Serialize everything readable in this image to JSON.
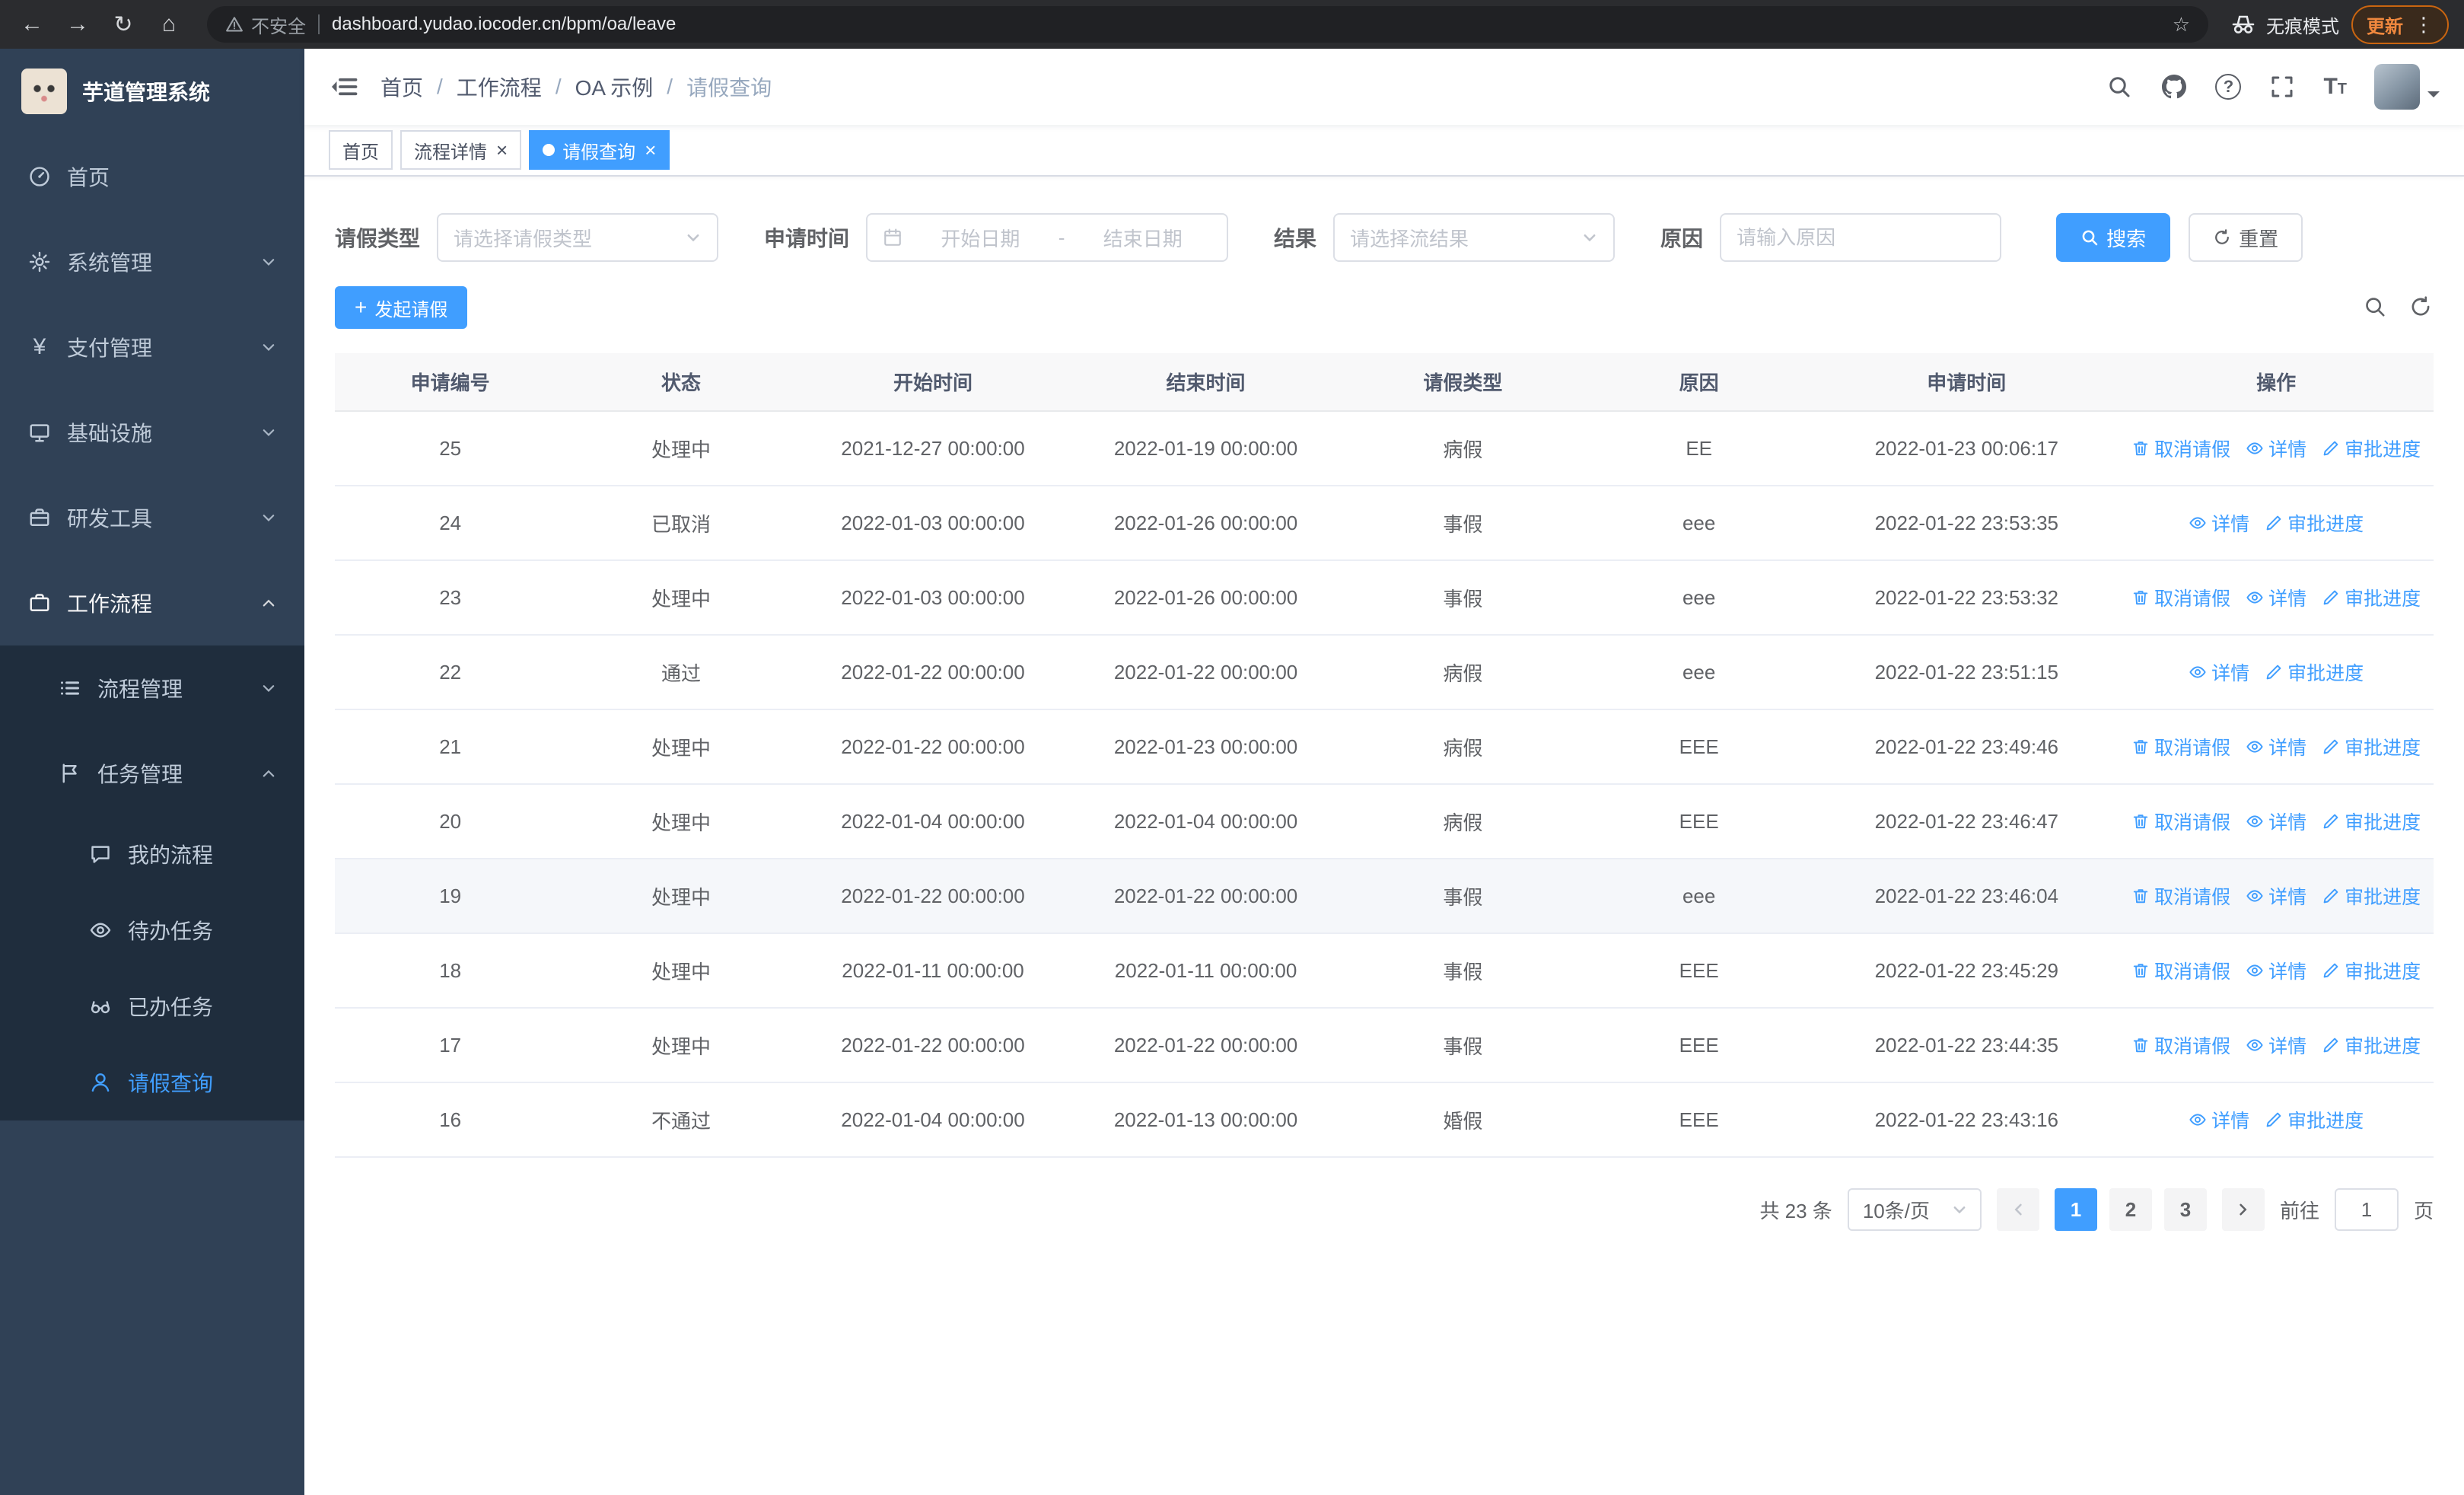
{
  "colors": {
    "accent": "#409eff",
    "sidebar_bg": "#304156",
    "sidebar_submenu_bg": "#1f2d3d",
    "link": "#409eff",
    "update_chip": "#f0883e"
  },
  "browser": {
    "security_label": "不安全",
    "url": "dashboard.yudao.iocoder.cn/bpm/oa/leave",
    "incognito_label": "无痕模式",
    "update_label": "更新"
  },
  "sidebar": {
    "logo_title": "芋道管理系统",
    "items": [
      {
        "label": "首页",
        "icon": "dashboard-icon",
        "level": 1,
        "active": false
      },
      {
        "label": "系统管理",
        "icon": "gear-icon",
        "level": 1,
        "expanded": false
      },
      {
        "label": "支付管理",
        "icon": "yen-icon",
        "level": 1,
        "expanded": false
      },
      {
        "label": "基础设施",
        "icon": "monitor-icon",
        "level": 1,
        "expanded": false
      },
      {
        "label": "研发工具",
        "icon": "briefcase-icon",
        "level": 1,
        "expanded": false
      },
      {
        "label": "工作流程",
        "icon": "briefcase-icon",
        "level": 1,
        "expanded": true
      },
      {
        "label": "流程管理",
        "icon": "list-icon",
        "level": 2,
        "expanded": false
      },
      {
        "label": "任务管理",
        "icon": "flag-icon",
        "level": 2,
        "expanded": true
      },
      {
        "label": "我的流程",
        "icon": "chat-icon",
        "level": 3,
        "active": false
      },
      {
        "label": "待办任务",
        "icon": "eye-icon",
        "level": 3,
        "active": false
      },
      {
        "label": "已办任务",
        "icon": "glasses-icon",
        "level": 3,
        "active": false
      },
      {
        "label": "请假查询",
        "icon": "user-icon",
        "level": 3,
        "active": true
      }
    ]
  },
  "breadcrumb": {
    "items": [
      "首页",
      "工作流程",
      "OA 示例",
      "请假查询"
    ]
  },
  "tabs": [
    {
      "label": "首页",
      "active": false,
      "closable": false
    },
    {
      "label": "流程详情",
      "active": false,
      "closable": true
    },
    {
      "label": "请假查询",
      "active": true,
      "closable": true
    }
  ],
  "filters": {
    "leave_type_label": "请假类型",
    "leave_type_placeholder": "请选择请假类型",
    "apply_time_label": "申请时间",
    "start_date_placeholder": "开始日期",
    "range_separator": "-",
    "end_date_placeholder": "结束日期",
    "result_label": "结果",
    "result_placeholder": "请选择流结果",
    "reason_label": "原因",
    "reason_placeholder": "请输入原因",
    "search_label": "搜索",
    "reset_label": "重置"
  },
  "toolbar": {
    "create_label": "发起请假"
  },
  "table": {
    "columns": [
      "申请编号",
      "状态",
      "开始时间",
      "结束时间",
      "请假类型",
      "原因",
      "申请时间",
      "操作"
    ],
    "action_labels": {
      "cancel": "取消请假",
      "detail": "详情",
      "progress": "审批进度"
    },
    "action_icons": {
      "cancel": "trash-icon",
      "detail": "eye-icon",
      "progress": "edit-icon"
    },
    "rows": [
      {
        "id": "25",
        "status": "处理中",
        "start": "2021-12-27 00:00:00",
        "end": "2022-01-19 00:00:00",
        "type": "病假",
        "reason": "EE",
        "apply_time": "2022-01-23 00:06:17",
        "actions": [
          "cancel",
          "detail",
          "progress"
        ],
        "highlight": false
      },
      {
        "id": "24",
        "status": "已取消",
        "start": "2022-01-03 00:00:00",
        "end": "2022-01-26 00:00:00",
        "type": "事假",
        "reason": "eee",
        "apply_time": "2022-01-22 23:53:35",
        "actions": [
          "detail",
          "progress"
        ],
        "highlight": false
      },
      {
        "id": "23",
        "status": "处理中",
        "start": "2022-01-03 00:00:00",
        "end": "2022-01-26 00:00:00",
        "type": "事假",
        "reason": "eee",
        "apply_time": "2022-01-22 23:53:32",
        "actions": [
          "cancel",
          "detail",
          "progress"
        ],
        "highlight": false
      },
      {
        "id": "22",
        "status": "通过",
        "start": "2022-01-22 00:00:00",
        "end": "2022-01-22 00:00:00",
        "type": "病假",
        "reason": "eee",
        "apply_time": "2022-01-22 23:51:15",
        "actions": [
          "detail",
          "progress"
        ],
        "highlight": false
      },
      {
        "id": "21",
        "status": "处理中",
        "start": "2022-01-22 00:00:00",
        "end": "2022-01-23 00:00:00",
        "type": "病假",
        "reason": "EEE",
        "apply_time": "2022-01-22 23:49:46",
        "actions": [
          "cancel",
          "detail",
          "progress"
        ],
        "highlight": false
      },
      {
        "id": "20",
        "status": "处理中",
        "start": "2022-01-04 00:00:00",
        "end": "2022-01-04 00:00:00",
        "type": "病假",
        "reason": "EEE",
        "apply_time": "2022-01-22 23:46:47",
        "actions": [
          "cancel",
          "detail",
          "progress"
        ],
        "highlight": false
      },
      {
        "id": "19",
        "status": "处理中",
        "start": "2022-01-22 00:00:00",
        "end": "2022-01-22 00:00:00",
        "type": "事假",
        "reason": "eee",
        "apply_time": "2022-01-22 23:46:04",
        "actions": [
          "cancel",
          "detail",
          "progress"
        ],
        "highlight": true
      },
      {
        "id": "18",
        "status": "处理中",
        "start": "2022-01-11 00:00:00",
        "end": "2022-01-11 00:00:00",
        "type": "事假",
        "reason": "EEE",
        "apply_time": "2022-01-22 23:45:29",
        "actions": [
          "cancel",
          "detail",
          "progress"
        ],
        "highlight": false
      },
      {
        "id": "17",
        "status": "处理中",
        "start": "2022-01-22 00:00:00",
        "end": "2022-01-22 00:00:00",
        "type": "事假",
        "reason": "EEE",
        "apply_time": "2022-01-22 23:44:35",
        "actions": [
          "cancel",
          "detail",
          "progress"
        ],
        "highlight": false
      },
      {
        "id": "16",
        "status": "不通过",
        "start": "2022-01-04 00:00:00",
        "end": "2022-01-13 00:00:00",
        "type": "婚假",
        "reason": "EEE",
        "apply_time": "2022-01-22 23:43:16",
        "actions": [
          "detail",
          "progress"
        ],
        "highlight": false
      }
    ]
  },
  "pagination": {
    "total_label": "共 23 条",
    "page_size_label": "10条/页",
    "pages": [
      "1",
      "2",
      "3"
    ],
    "active_page": "1",
    "prev_disabled": true,
    "goto_label": "前往",
    "goto_value": "1",
    "goto_suffix_label": "页"
  }
}
